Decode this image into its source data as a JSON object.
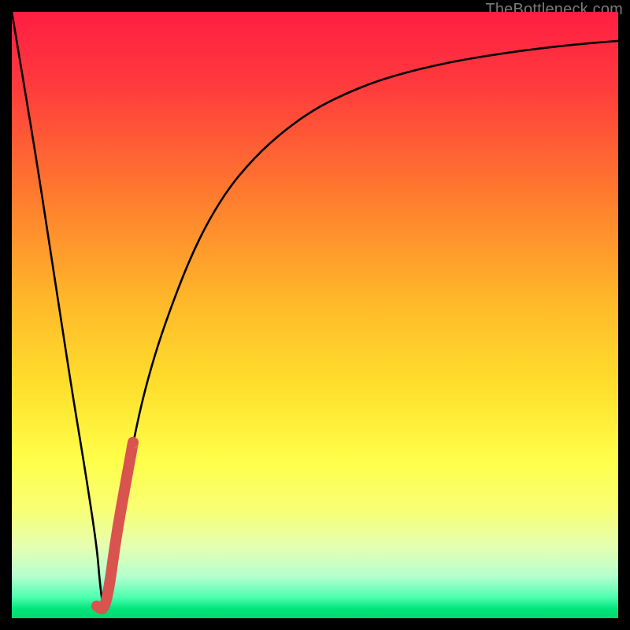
{
  "watermark": {
    "text": "TheBottleneck.com"
  },
  "colors": {
    "frame": "#000000",
    "watermark": "#7a7a7a",
    "curve": "#000000",
    "accent_segment": "#d9534f",
    "gradient_stops": [
      {
        "offset": 0.0,
        "color": "#ff1e42"
      },
      {
        "offset": 0.12,
        "color": "#ff3a3d"
      },
      {
        "offset": 0.3,
        "color": "#ff7a2e"
      },
      {
        "offset": 0.48,
        "color": "#ffb92a"
      },
      {
        "offset": 0.62,
        "color": "#ffe02d"
      },
      {
        "offset": 0.74,
        "color": "#ffff4a"
      },
      {
        "offset": 0.82,
        "color": "#f8ff73"
      },
      {
        "offset": 0.88,
        "color": "#e6ffb0"
      },
      {
        "offset": 0.93,
        "color": "#b6ffcf"
      },
      {
        "offset": 0.965,
        "color": "#4fffb0"
      },
      {
        "offset": 0.985,
        "color": "#00e57a"
      },
      {
        "offset": 1.0,
        "color": "#00d873"
      }
    ]
  },
  "chart_data": {
    "type": "line",
    "title": "",
    "xlabel": "",
    "ylabel": "",
    "xlim": [
      0,
      100
    ],
    "ylim": [
      0,
      100
    ],
    "grid": false,
    "legend": false,
    "series": [
      {
        "name": "bottleneck-curve",
        "stroke": "curve",
        "x": [
          0,
          2,
          4,
          6,
          8,
          10,
          12,
          14,
          14.5,
          15,
          15.5,
          16,
          18,
          20,
          22,
          25,
          30,
          35,
          40,
          45,
          50,
          55,
          60,
          65,
          70,
          75,
          80,
          85,
          90,
          95,
          100
        ],
        "y": [
          100,
          88,
          76,
          63,
          50,
          37,
          25,
          12,
          6,
          2,
          2,
          6,
          18,
          29,
          38,
          48,
          61,
          70,
          76,
          80.5,
          84,
          86.5,
          88.5,
          90,
          91.2,
          92.2,
          93,
          93.7,
          94.3,
          94.8,
          95.2
        ]
      },
      {
        "name": "accent-segment",
        "stroke": "accent_segment",
        "thick": true,
        "x": [
          14.0,
          14.3,
          14.6,
          15.0,
          15.5,
          16.2,
          17.0,
          18.0,
          19.0,
          20.0
        ],
        "y": [
          2.0,
          1.8,
          1.6,
          1.5,
          2.5,
          6.0,
          12.0,
          18.0,
          23.5,
          29.0
        ]
      }
    ],
    "background_gradient": "vertical red→yellow→green"
  }
}
